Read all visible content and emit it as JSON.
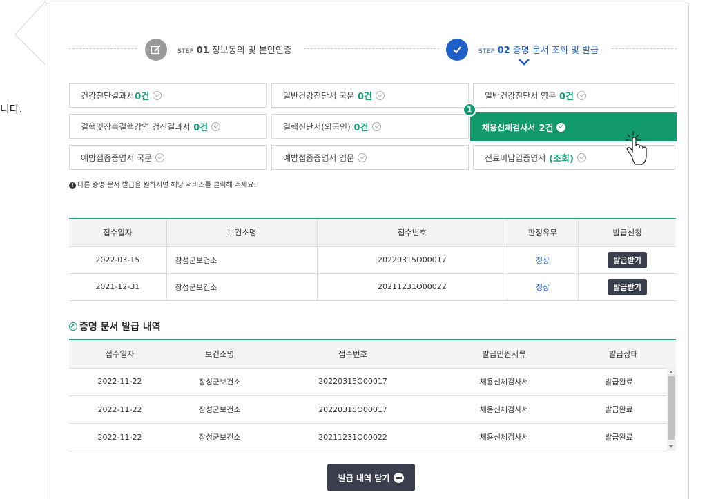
{
  "cut_text": "니다.",
  "steps": {
    "step1": {
      "prefix": "STEP",
      "num": "01",
      "label": "정보동의 및 본인인증"
    },
    "step2": {
      "prefix": "STEP",
      "num": "02",
      "label": "증명 문서 조회 및 발급"
    }
  },
  "services": [
    {
      "label": "건강진단결과서",
      "count": "0건"
    },
    {
      "label": "일반건강진단서 국문",
      "count": "0건"
    },
    {
      "label": "일반건강진단서 영문",
      "count": "0건"
    },
    {
      "label": "결핵및잠복결핵감염 검진결과서",
      "count": "0건"
    },
    {
      "label": "결핵진단서(외국인)",
      "count": "0건"
    },
    {
      "label": "채용신체검사서",
      "count": "2건"
    },
    {
      "label": "예방접종증명서 국문",
      "count": ""
    },
    {
      "label": "예방접종증명서 영문",
      "count": ""
    },
    {
      "label": "진료비납입증명서",
      "count": "(조회)"
    }
  ],
  "badge": "1",
  "notice": "다른 증명 문서 발급을 원하시면 해당 서비스를 클릭해 주세요!",
  "receipt_table": {
    "headers": [
      "접수일자",
      "보건소명",
      "접수번호",
      "판정유무",
      "발급신청"
    ],
    "rows": [
      {
        "date": "2022-03-15",
        "center": "장성군보건소",
        "no": "20220315O00017",
        "result": "정상",
        "action": "발급받기"
      },
      {
        "date": "2021-12-31",
        "center": "장성군보건소",
        "no": "20211231O00022",
        "result": "정상",
        "action": "발급받기"
      }
    ]
  },
  "history": {
    "title": "증명 문서 발급 내역",
    "headers": [
      "접수일자",
      "보건소명",
      "접수번호",
      "발급민원서류",
      "발급상태"
    ],
    "rows": [
      {
        "date": "2022-11-22",
        "center": "장성군보건소",
        "no": "20220315O00017",
        "doc": "채용신체검사서",
        "status": "발급완료"
      },
      {
        "date": "2022-11-22",
        "center": "장성군보건소",
        "no": "20220315O00017",
        "doc": "채용신체검사서",
        "status": "발급완료"
      },
      {
        "date": "2022-11-22",
        "center": "장성군보건소",
        "no": "20211231O00022",
        "doc": "채용신체검사서",
        "status": "발급완료"
      }
    ]
  },
  "close_button": "발급 내역 닫기",
  "colors": {
    "accent": "#139a6c",
    "step_active": "#1f5fc6",
    "dark_button": "#3a3d4b"
  }
}
